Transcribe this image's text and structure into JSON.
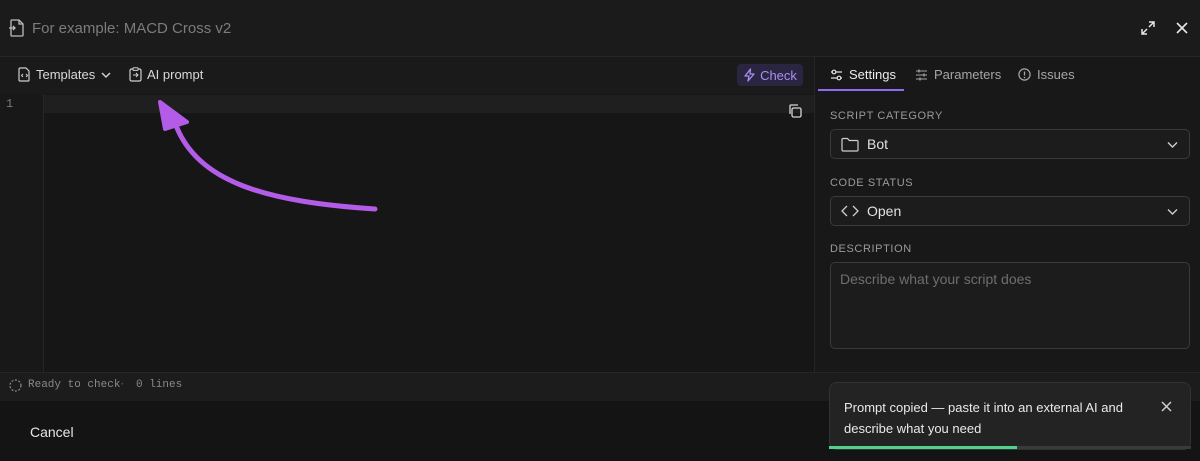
{
  "titlebar": {
    "placeholder": "For example: MACD Cross v2",
    "icons": {
      "file": "file-icon",
      "expand": "expand-icon",
      "close": "close-icon"
    }
  },
  "toolbar": {
    "templates_label": "Templates",
    "ai_prompt_label": "AI prompt",
    "check_label": "Check",
    "check_color": "#a98ff0"
  },
  "editor": {
    "line_numbers": [
      "1"
    ]
  },
  "status": {
    "state": "Ready to check",
    "separator": "·",
    "lines": "0 lines"
  },
  "panel": {
    "tabs": [
      {
        "label": "Settings",
        "icon": "sliders-icon",
        "active": true
      },
      {
        "label": "Parameters",
        "icon": "params-icon",
        "active": false
      },
      {
        "label": "Issues",
        "icon": "info-circle-icon",
        "active": false
      }
    ],
    "script_category": {
      "label": "SCRIPT CATEGORY",
      "value": "Bot",
      "icon": "folder-icon"
    },
    "code_status": {
      "label": "CODE STATUS",
      "value": "Open",
      "icon": "code-icon"
    },
    "description": {
      "label": "DESCRIPTION",
      "placeholder": "Describe what your script does"
    },
    "accent": "#8e6bf0"
  },
  "footer": {
    "cancel_label": "Cancel"
  },
  "toast": {
    "message": "Prompt copied — paste it into an external AI and describe what you need",
    "progress": 0.52,
    "progress_color": "#4fd28a"
  }
}
